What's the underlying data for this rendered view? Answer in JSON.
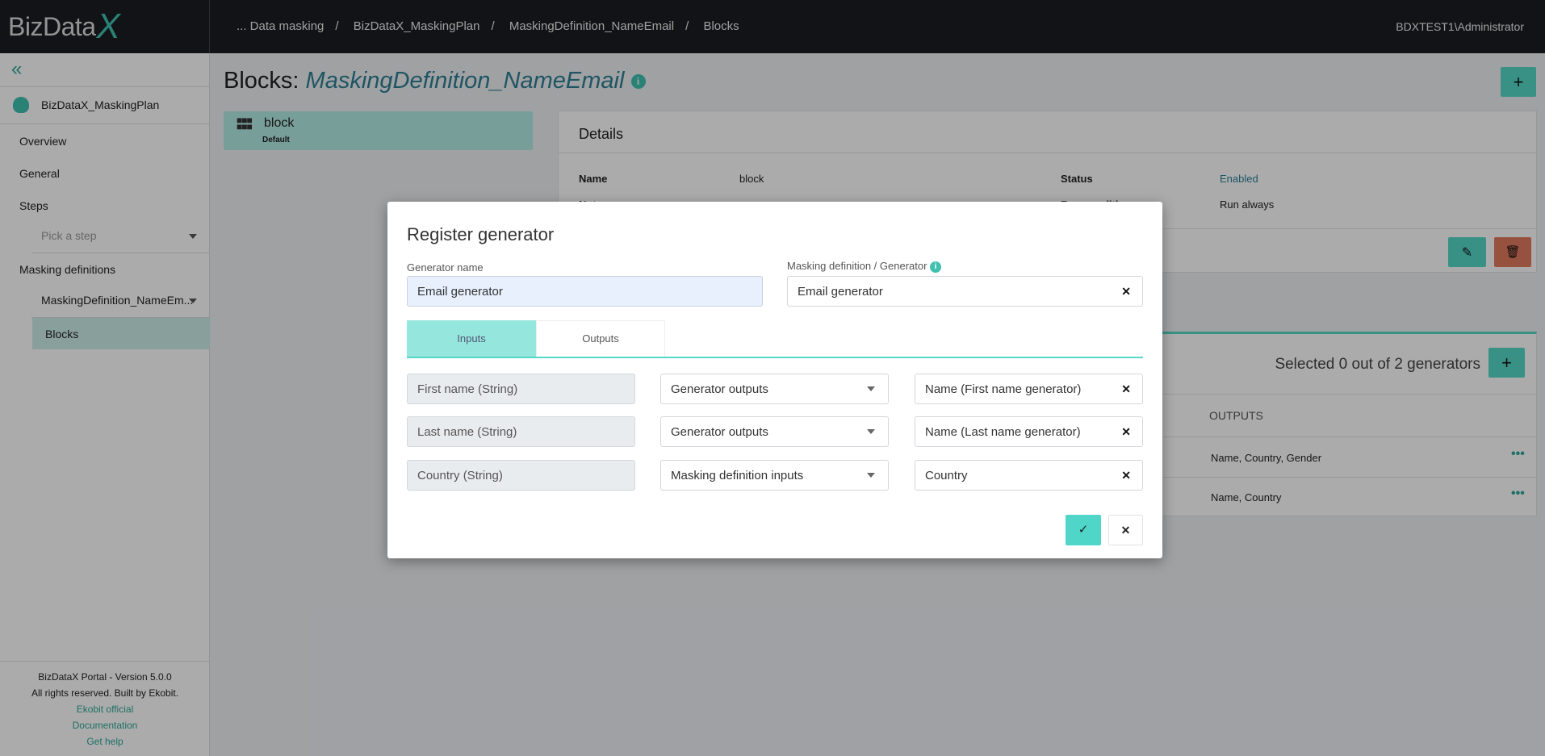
{
  "header": {
    "logo": "BizData",
    "logo_x": "X",
    "breadcrumb": [
      "... Data masking",
      "BizDataX_MaskingPlan",
      "MaskingDefinition_NameEmail",
      "Blocks"
    ],
    "user": "BDXTEST1\\Administrator"
  },
  "sidebar": {
    "plan": "BizDataX_MaskingPlan",
    "items": [
      "Overview",
      "General",
      "Steps"
    ],
    "step_placeholder": "Pick a step",
    "masking_definitions": "Masking definitions",
    "definition": "MaskingDefinition_NameEm...",
    "blocks": "Blocks",
    "footer": {
      "version": "BizDataX Portal - Version 5.0.0",
      "rights": "All rights reserved. Built by Ekobit.",
      "links": [
        "Ekobit official",
        "Documentation",
        "Get help"
      ]
    }
  },
  "page": {
    "title_prefix": "Blocks:",
    "title_name": "MaskingDefinition_NameEmail",
    "info_icon": "i",
    "add": "+",
    "block": {
      "name": "block",
      "badge": "Default"
    },
    "details": {
      "title": "Details",
      "name_label": "Name",
      "name_value": "block",
      "status_label": "Status",
      "status_value": "Enabled",
      "row2_left": "Note",
      "row2_right_label": "Run condition",
      "row2_right_value": "Run always"
    },
    "generators": {
      "selected": "Selected 0 out of 2 generators",
      "outputs_header": "OUTPUTS",
      "rows": [
        {
          "outputs": "Name, Country, Gender"
        },
        {
          "outputs": "Name, Country"
        }
      ]
    }
  },
  "modal": {
    "title": "Register generator",
    "generator_name_label": "Generator name",
    "generator_name_value": "Email generator",
    "md_label": "Masking definition / Generator",
    "md_value": "Email generator",
    "tabs": [
      "Inputs",
      "Outputs"
    ],
    "active_tab": "Inputs",
    "rows": [
      {
        "input": "First name (String)",
        "source": "Generator outputs",
        "value": "Name (First name generator)"
      },
      {
        "input": "Last name (String)",
        "source": "Generator outputs",
        "value": "Name (Last name generator)"
      },
      {
        "input": "Country (String)",
        "source": "Masking definition inputs",
        "value": "Country"
      }
    ],
    "clear": "✕",
    "ok": "✓",
    "cancel": "✕"
  },
  "colors": {
    "accent": "#55d8c8",
    "danger": "#e07a5f",
    "header": "#1c1d21"
  }
}
